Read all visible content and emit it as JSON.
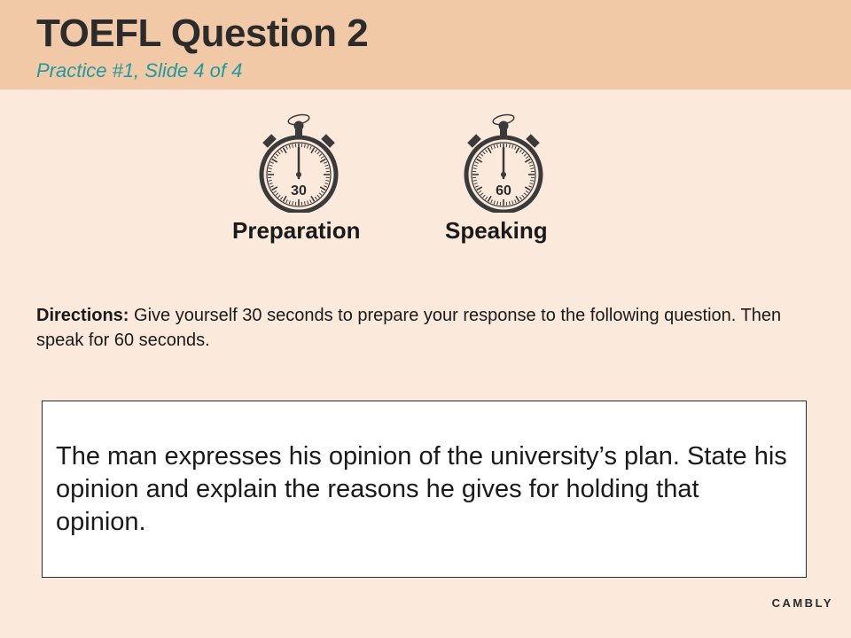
{
  "header": {
    "title": "TOEFL Question 2",
    "subtitle": "Practice #1, Slide 4 of 4"
  },
  "timers": [
    {
      "label": "Preparation",
      "seconds": "30",
      "icon": "stopwatch-icon"
    },
    {
      "label": "Speaking",
      "seconds": "60",
      "icon": "stopwatch-icon"
    }
  ],
  "directions": {
    "lead": "Directions:",
    "text": " Give yourself 30 seconds to prepare your response to the following question. Then speak for 60 seconds."
  },
  "question": {
    "text": "The man expresses his opinion of the university’s plan. State his opinion and explain the reasons he gives for holding that opinion."
  },
  "brand": "CAMBLY",
  "colors": {
    "header_bg": "#f2c9a7",
    "page_bg": "#fbe9dc",
    "subtitle": "#1e9aa0",
    "text": "#2b2b2b"
  }
}
